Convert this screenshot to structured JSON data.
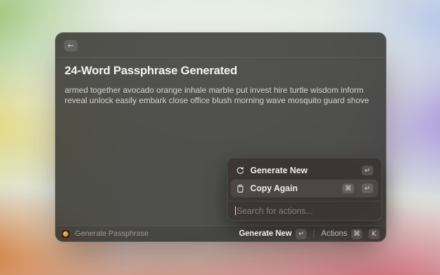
{
  "window": {
    "back_icon": "←"
  },
  "main": {
    "title": "24-Word Passphrase Generated",
    "passphrase": "armed together avocado orange inhale marble put invest hire turtle wisdom inform reveal unlock easily embark close office blush morning wave mosquito guard shove"
  },
  "action_panel": {
    "items": [
      {
        "icon": "refresh-icon",
        "label": "Generate New",
        "shortcut": [
          "↵"
        ],
        "selected": false
      },
      {
        "icon": "clipboard-icon",
        "label": "Copy Again",
        "shortcut": [
          "⌘",
          "↵"
        ],
        "selected": true
      }
    ],
    "search_placeholder": "Search for actions..."
  },
  "footer": {
    "app_label": "Generate Passphrase",
    "primary_action": "Generate New",
    "primary_shortcut": "↵",
    "actions_label": "Actions",
    "actions_shortcuts": [
      "⌘",
      "K"
    ]
  },
  "colors": {
    "app_icon_accent": "#e09a3e",
    "selected_row_highlight": "rgba(255,255,255,0.09)"
  }
}
